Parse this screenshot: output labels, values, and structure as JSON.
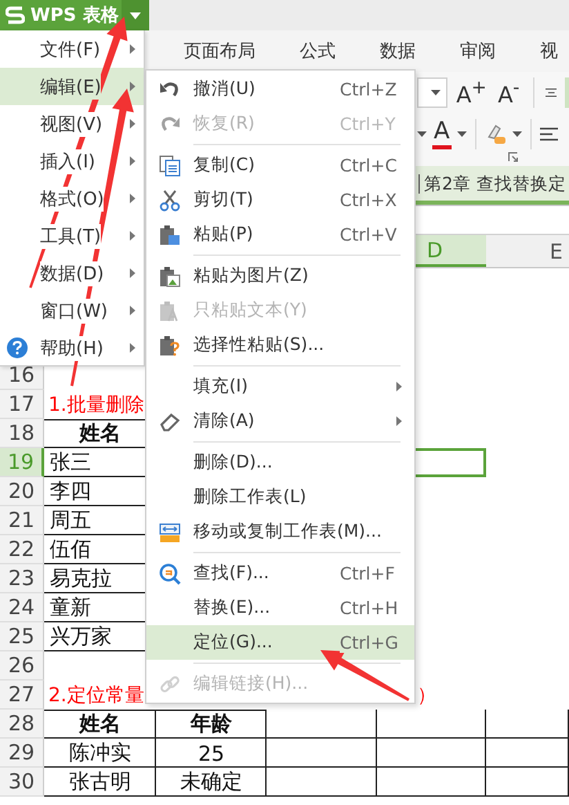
{
  "app_button": {
    "label": "WPS 表格"
  },
  "ribbon_tabs": [
    {
      "label": "页面布局"
    },
    {
      "label": "公式"
    },
    {
      "label": "数据"
    },
    {
      "label": "审阅"
    },
    {
      "label": "视"
    }
  ],
  "font_size_buttons": [
    "A$^{+}$",
    "A$^{-}$"
  ],
  "font_color_button": {
    "label": "A"
  },
  "document_tab": {
    "label": "第2章 查找替换定"
  },
  "column_headers": [
    {
      "label": "D",
      "selected": true
    },
    {
      "label": "E",
      "selected": false
    }
  ],
  "rows": [
    {
      "number": "16",
      "selected": false,
      "cells": [
        {
          "kind": "blank"
        },
        {
          "kind": "blank"
        },
        {
          "kind": "blank"
        },
        {
          "kind": "blank"
        },
        {
          "kind": "blank"
        }
      ]
    },
    {
      "number": "17",
      "selected": false,
      "cells": [
        {
          "kind": "note",
          "text": "1.批量删除"
        },
        {
          "kind": "blank"
        },
        {
          "kind": "blank"
        },
        {
          "kind": "blank"
        },
        {
          "kind": "blank"
        }
      ]
    },
    {
      "number": "18",
      "selected": false,
      "cells": [
        {
          "kind": "heading",
          "text": "姓名"
        },
        {
          "kind": "blank"
        },
        {
          "kind": "blank"
        },
        {
          "kind": "blank"
        },
        {
          "kind": "blank"
        }
      ]
    },
    {
      "number": "19",
      "selected": true,
      "cells": [
        {
          "kind": "name",
          "text": "张三"
        },
        {
          "kind": "blank"
        },
        {
          "kind": "blank"
        },
        {
          "kind": "blank"
        },
        {
          "kind": "blank"
        }
      ]
    },
    {
      "number": "20",
      "selected": false,
      "cells": [
        {
          "kind": "name",
          "text": "李四"
        },
        {
          "kind": "blank"
        },
        {
          "kind": "blank"
        },
        {
          "kind": "blank"
        },
        {
          "kind": "blank"
        }
      ]
    },
    {
      "number": "21",
      "selected": false,
      "cells": [
        {
          "kind": "name",
          "text": "周五"
        },
        {
          "kind": "blank"
        },
        {
          "kind": "blank"
        },
        {
          "kind": "blank"
        },
        {
          "kind": "blank"
        }
      ]
    },
    {
      "number": "22",
      "selected": false,
      "cells": [
        {
          "kind": "name",
          "text": "伍佰"
        },
        {
          "kind": "blank"
        },
        {
          "kind": "blank"
        },
        {
          "kind": "blank"
        },
        {
          "kind": "blank"
        }
      ]
    },
    {
      "number": "23",
      "selected": false,
      "cells": [
        {
          "kind": "name",
          "text": "易克拉"
        },
        {
          "kind": "blank"
        },
        {
          "kind": "blank"
        },
        {
          "kind": "blank"
        },
        {
          "kind": "blank"
        }
      ]
    },
    {
      "number": "24",
      "selected": false,
      "cells": [
        {
          "kind": "name",
          "text": "童新"
        },
        {
          "kind": "blank"
        },
        {
          "kind": "blank"
        },
        {
          "kind": "blank"
        },
        {
          "kind": "blank"
        }
      ]
    },
    {
      "number": "25",
      "selected": false,
      "cells": [
        {
          "kind": "name",
          "text": "兴万家"
        },
        {
          "kind": "blank"
        },
        {
          "kind": "blank"
        },
        {
          "kind": "blank"
        },
        {
          "kind": "blank"
        }
      ]
    },
    {
      "number": "26",
      "selected": false,
      "cells": [
        {
          "kind": "blank"
        },
        {
          "kind": "blank"
        },
        {
          "kind": "blank"
        },
        {
          "kind": "blank"
        },
        {
          "kind": "blank"
        }
      ]
    },
    {
      "number": "27",
      "selected": false,
      "cells": [
        {
          "kind": "note",
          "text": "2.定位常量"
        },
        {
          "kind": "blank"
        },
        {
          "kind": "blank"
        },
        {
          "kind": "note_tail",
          "text": "）"
        },
        {
          "kind": "blank"
        }
      ]
    },
    {
      "number": "28",
      "selected": false,
      "cells": [
        {
          "kind": "heading",
          "text": "姓名"
        },
        {
          "kind": "heading",
          "text": "年龄"
        },
        {
          "kind": "cell"
        },
        {
          "kind": "cell"
        },
        {
          "kind": "cell"
        }
      ]
    },
    {
      "number": "29",
      "selected": false,
      "cells": [
        {
          "kind": "value",
          "text": "陈冲实"
        },
        {
          "kind": "value",
          "text": "25"
        },
        {
          "kind": "cell"
        },
        {
          "kind": "cell"
        },
        {
          "kind": "cell"
        }
      ]
    },
    {
      "number": "30",
      "selected": false,
      "cells": [
        {
          "kind": "value",
          "text": "张古明"
        },
        {
          "kind": "value",
          "text": "未确定"
        },
        {
          "kind": "cell"
        },
        {
          "kind": "cell"
        },
        {
          "kind": "cell"
        }
      ]
    }
  ],
  "main_menu": {
    "items": [
      {
        "label": "文件(F)",
        "selected": false
      },
      {
        "label": "编辑(E)",
        "selected": true
      },
      {
        "label": "视图(V)",
        "selected": false
      },
      {
        "label": "插入(I)",
        "selected": false
      },
      {
        "label": "格式(O)",
        "selected": false
      },
      {
        "label": "工具(T)",
        "selected": false
      },
      {
        "label": "数据(D)",
        "selected": false
      },
      {
        "label": "窗口(W)",
        "selected": false
      },
      {
        "label": "帮助(H)",
        "selected": false
      }
    ]
  },
  "edit_submenu": {
    "items": [
      {
        "kind": "item",
        "label": "撤消(U)",
        "shortcut": "Ctrl+Z",
        "disabled": false,
        "selected": false
      },
      {
        "kind": "item",
        "label": "恢复(R)",
        "shortcut": "Ctrl+Y",
        "disabled": true,
        "selected": false
      },
      {
        "kind": "separator"
      },
      {
        "kind": "item",
        "label": "复制(C)",
        "shortcut": "Ctrl+C",
        "disabled": false,
        "selected": false
      },
      {
        "kind": "item",
        "label": "剪切(T)",
        "shortcut": "Ctrl+X",
        "disabled": false,
        "selected": false
      },
      {
        "kind": "item",
        "label": "粘贴(P)",
        "shortcut": "Ctrl+V",
        "disabled": false,
        "selected": false
      },
      {
        "kind": "separator"
      },
      {
        "kind": "item",
        "label": "粘贴为图片(Z)",
        "disabled": false,
        "selected": false
      },
      {
        "kind": "item",
        "label": "只粘贴文本(Y)",
        "disabled": true,
        "selected": false
      },
      {
        "kind": "item",
        "label": "选择性粘贴(S)...",
        "disabled": false,
        "selected": false
      },
      {
        "kind": "separator"
      },
      {
        "kind": "submenu",
        "label": "填充(I)",
        "disabled": false,
        "selected": false
      },
      {
        "kind": "submenu",
        "label": "清除(A)",
        "disabled": false,
        "selected": false
      },
      {
        "kind": "separator"
      },
      {
        "kind": "item",
        "label": "删除(D)...",
        "disabled": false,
        "selected": false
      },
      {
        "kind": "item",
        "label": "删除工作表(L)",
        "disabled": false,
        "selected": false
      },
      {
        "kind": "item",
        "label": "移动或复制工作表(M)...",
        "disabled": false,
        "selected": false
      },
      {
        "kind": "separator"
      },
      {
        "kind": "item",
        "label": "查找(F)...",
        "shortcut": "Ctrl+F",
        "disabled": false,
        "selected": false
      },
      {
        "kind": "item",
        "label": "替换(E)...",
        "shortcut": "Ctrl+H",
        "disabled": false,
        "selected": false
      },
      {
        "kind": "item",
        "label": "定位(G)...",
        "shortcut": "Ctrl+G",
        "disabled": false,
        "selected": true
      },
      {
        "kind": "separator"
      },
      {
        "kind": "item",
        "label": "编辑链接(H)...",
        "disabled": true,
        "selected": false
      }
    ]
  }
}
